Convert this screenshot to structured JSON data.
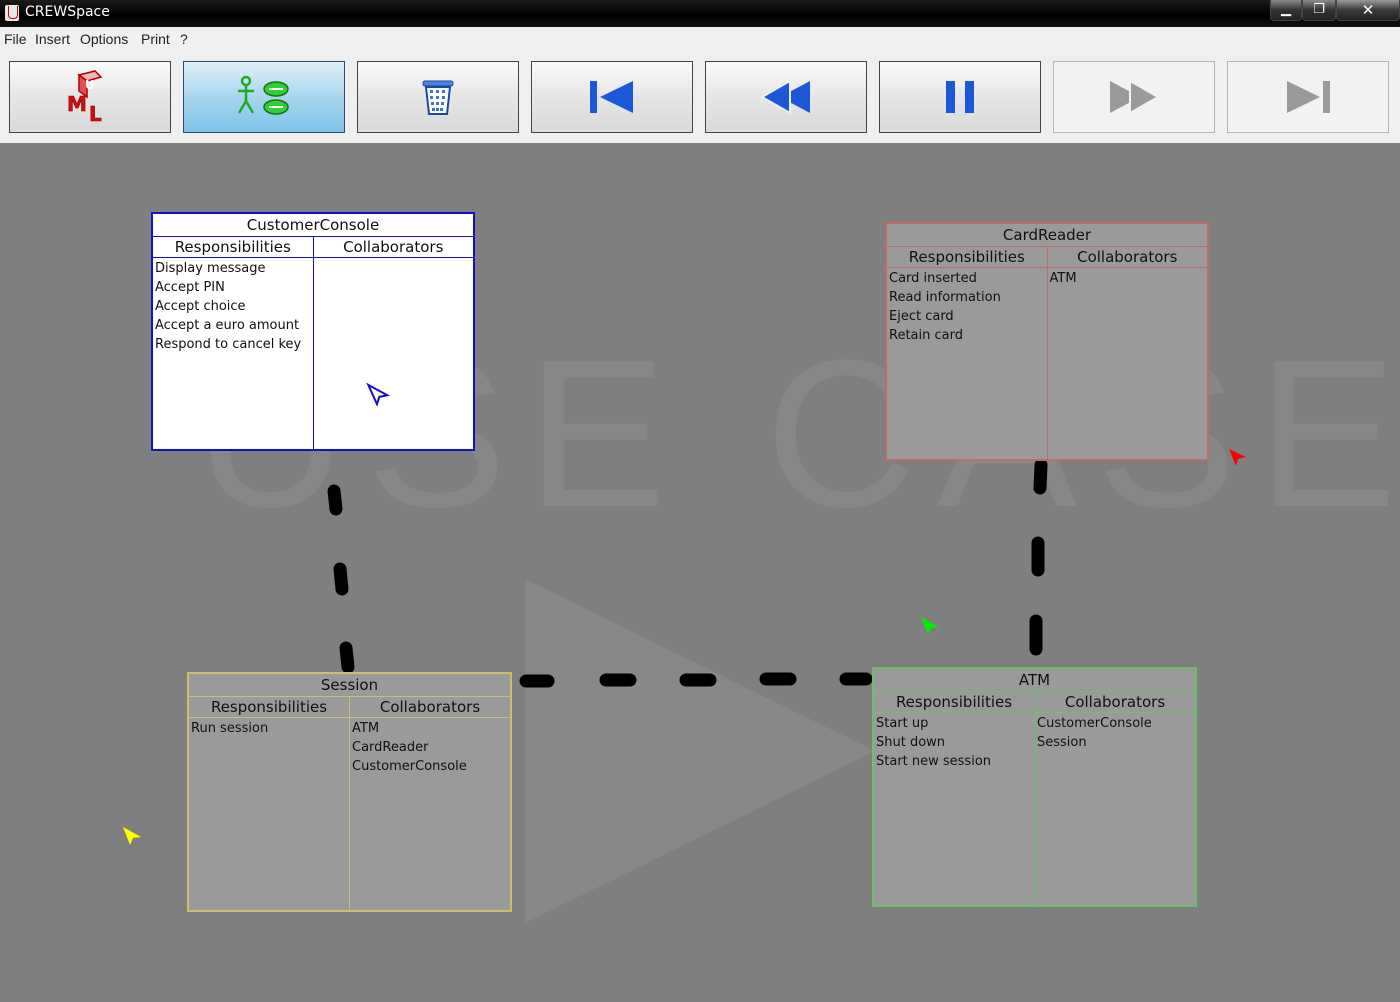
{
  "window": {
    "title": "CREWSpace"
  },
  "menu": [
    "File",
    "Insert",
    "Options",
    "Print",
    "?"
  ],
  "toolbar": {
    "buttons": [
      {
        "name": "uml-button",
        "icon": "uml-icon",
        "state": "normal"
      },
      {
        "name": "crc-mode-button",
        "icon": "crc-icon",
        "state": "active"
      },
      {
        "name": "delete-button",
        "icon": "trash-icon",
        "state": "normal"
      },
      {
        "name": "first-button",
        "icon": "skip-start-icon",
        "state": "normal"
      },
      {
        "name": "rewind-button",
        "icon": "rewind-icon",
        "state": "normal"
      },
      {
        "name": "pause-button",
        "icon": "pause-icon",
        "state": "normal"
      },
      {
        "name": "forward-button",
        "icon": "fast-forward-icon",
        "state": "disabled"
      },
      {
        "name": "last-button",
        "icon": "skip-end-icon",
        "state": "disabled"
      }
    ]
  },
  "watermark": "USE CASE",
  "cards": {
    "customerconsole": {
      "title": "CustomerConsole",
      "resp_header": "Responsibilities",
      "collab_header": "Collaborators",
      "responsibilities": [
        "Display message",
        "Accept PIN",
        "Accept choice",
        "Accept a euro amount",
        "Respond to cancel key"
      ],
      "collaborators": [],
      "color": "#1010cc"
    },
    "cardreader": {
      "title": "CardReader",
      "resp_header": "Responsibilities",
      "collab_header": "Collaborators",
      "responsibilities": [
        "Card inserted",
        "Read information",
        "Eject card",
        "Retain card"
      ],
      "collaborators": [
        "ATM"
      ],
      "color": "#c06a6a"
    },
    "session": {
      "title": "Session",
      "resp_header": "Responsibilities",
      "collab_header": "Collaborators",
      "responsibilities": [
        "Run session"
      ],
      "collaborators": [
        "ATM",
        "CardReader",
        "CustomerConsole"
      ],
      "color": "#c8c070"
    },
    "atm": {
      "title": "ATM",
      "resp_header": "Responsibilities",
      "collab_header": "Collaborators",
      "responsibilities": [
        "Start up",
        "Shut down",
        "Start new session"
      ],
      "collaborators": [
        "CustomerConsole",
        "Session"
      ],
      "color": "#6cc06c"
    }
  },
  "cursors": [
    {
      "name": "blue-user-cursor",
      "color": "#1010cc"
    },
    {
      "name": "red-user-cursor",
      "color": "#ff0000"
    },
    {
      "name": "green-user-cursor",
      "color": "#00ee00"
    },
    {
      "name": "yellow-user-cursor",
      "color": "#ffff00"
    }
  ]
}
